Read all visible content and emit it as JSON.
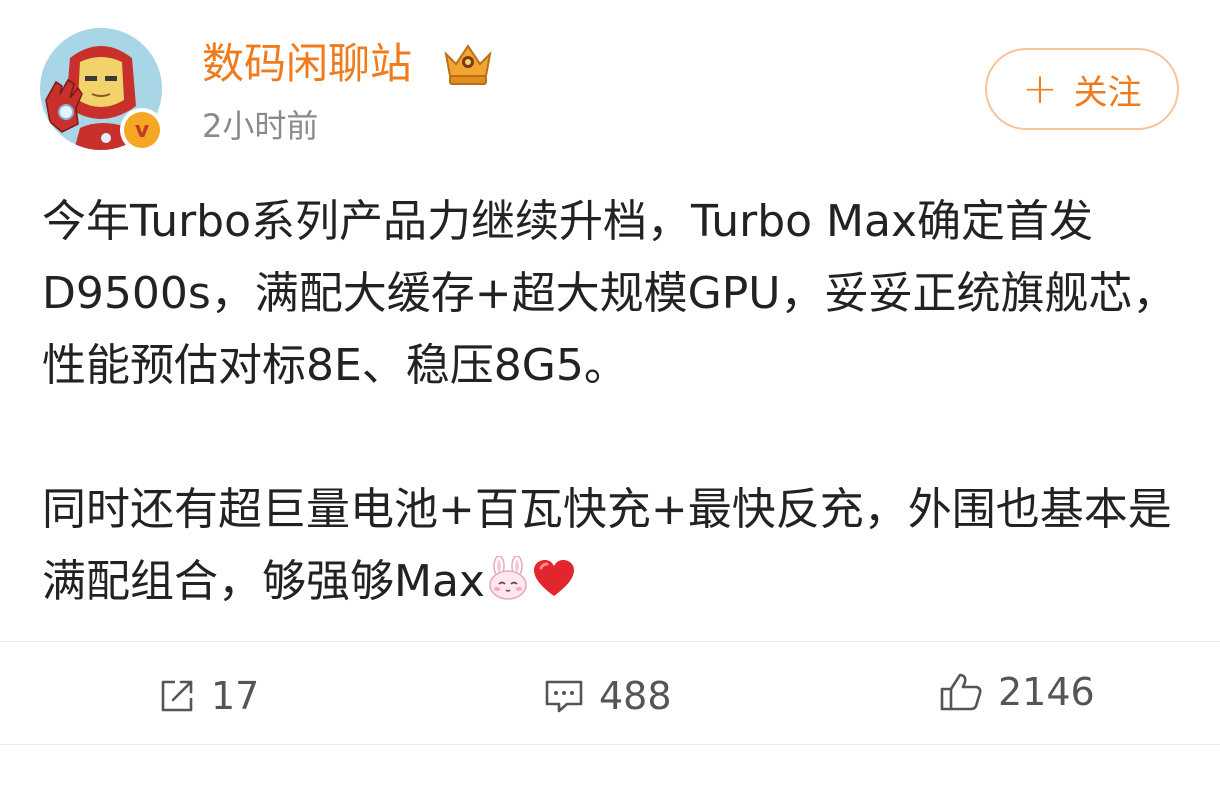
{
  "author": {
    "name": "数码闲聊站",
    "time": "2小时前",
    "verified_mark": "v",
    "avatar_icon": "iron-man-avatar-icon",
    "badge_icon": "crown-icon"
  },
  "follow_button": {
    "plus": "+",
    "label": "关注"
  },
  "post": {
    "paragraph1": "今年Turbo系列产品力继续升档，Turbo Max确定首发D9500s，满配大缓存+超大规模GPU，妥妥正统旗舰芯，性能预估对标8E、稳压8G5。",
    "paragraph2_text": "同时还有超巨量电池+百瓦快充+最快反充，外围也基本是满配组合，够强够Max",
    "emojis": [
      "rabbit-face-emoji",
      "red-heart-emoji"
    ]
  },
  "actions": {
    "repost": {
      "icon": "share-icon",
      "count": "17"
    },
    "comment": {
      "icon": "comment-icon",
      "count": "488"
    },
    "like": {
      "icon": "thumbs-up-icon",
      "count": "2146"
    }
  },
  "colors": {
    "accent": "#f07b1d",
    "text": "#222222",
    "muted": "#8a8a8a",
    "follow_border": "#f5c49b"
  }
}
